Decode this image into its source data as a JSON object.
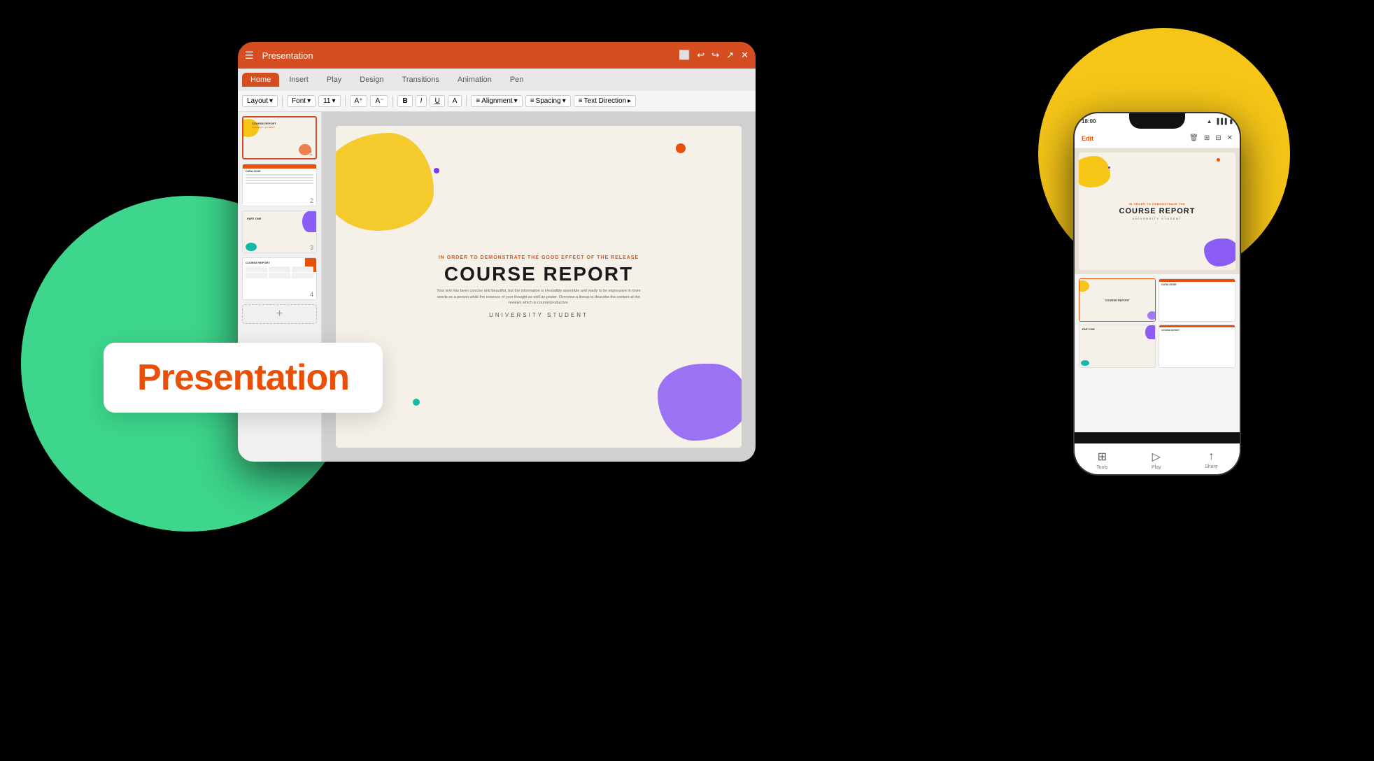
{
  "background": "#000000",
  "circles": {
    "green": {
      "color": "#3DD68C"
    },
    "yellow": {
      "color": "#F5C518"
    }
  },
  "presentation_label": {
    "text": "Presentation",
    "color": "#E8500A"
  },
  "tablet": {
    "title": "Presentation",
    "title_bar_color": "#D44E22",
    "nav_tabs": [
      "Home",
      "Insert",
      "Play",
      "Design",
      "Transitions",
      "Animation",
      "Pen"
    ],
    "active_tab": "Home",
    "toolbar": {
      "layout": "Layout",
      "font": "Font",
      "font_size": "11",
      "bold": "B",
      "italic": "I",
      "underline": "U",
      "text_color": "A",
      "alignment": "Alignment",
      "spacing": "Spacing",
      "text_direction": "Text Direction"
    },
    "slides": [
      {
        "number": "1",
        "title": "COURSE REPORT",
        "active": true
      },
      {
        "number": "2",
        "title": "CATALOGUE",
        "active": false
      },
      {
        "number": "3",
        "title": "PART ONE",
        "active": false
      },
      {
        "number": "4",
        "title": "COURSE REPORT",
        "active": false
      }
    ],
    "add_slide_label": "+",
    "main_slide": {
      "subtitle_top": "IN ORDER TO DEMONSTRATE THE GOOD EFFECT OF THE RELEASE",
      "title": "COURSE REPORT",
      "body": "Your text has been concise and beautiful, but the information is irresistibly assemble and ready to be expressive in more words so a person while the essence of your thought as well as poster. Overview a lineup to describe the content at the reviews which is counterproductive.",
      "author": "UNIVERSITY STUDENT"
    }
  },
  "phone": {
    "status_time": "18:00",
    "wifi_icon": "wifi",
    "battery_icon": "battery",
    "toolbar": {
      "edit": "Edit",
      "delete_icon": "🗑",
      "grid_icon": "⊞",
      "grid2_icon": "⊟",
      "close": "✕"
    },
    "slide": {
      "subtitle": "IN ORDER TO DEMONSTRATE THE",
      "title": "COURSE REPORT",
      "author": "UNIVERSITY STUDENT"
    },
    "bottom_nav": [
      {
        "icon": "⊞",
        "label": "Tools"
      },
      {
        "icon": "▷",
        "label": "Play"
      },
      {
        "icon": "↑",
        "label": "Share"
      }
    ]
  }
}
